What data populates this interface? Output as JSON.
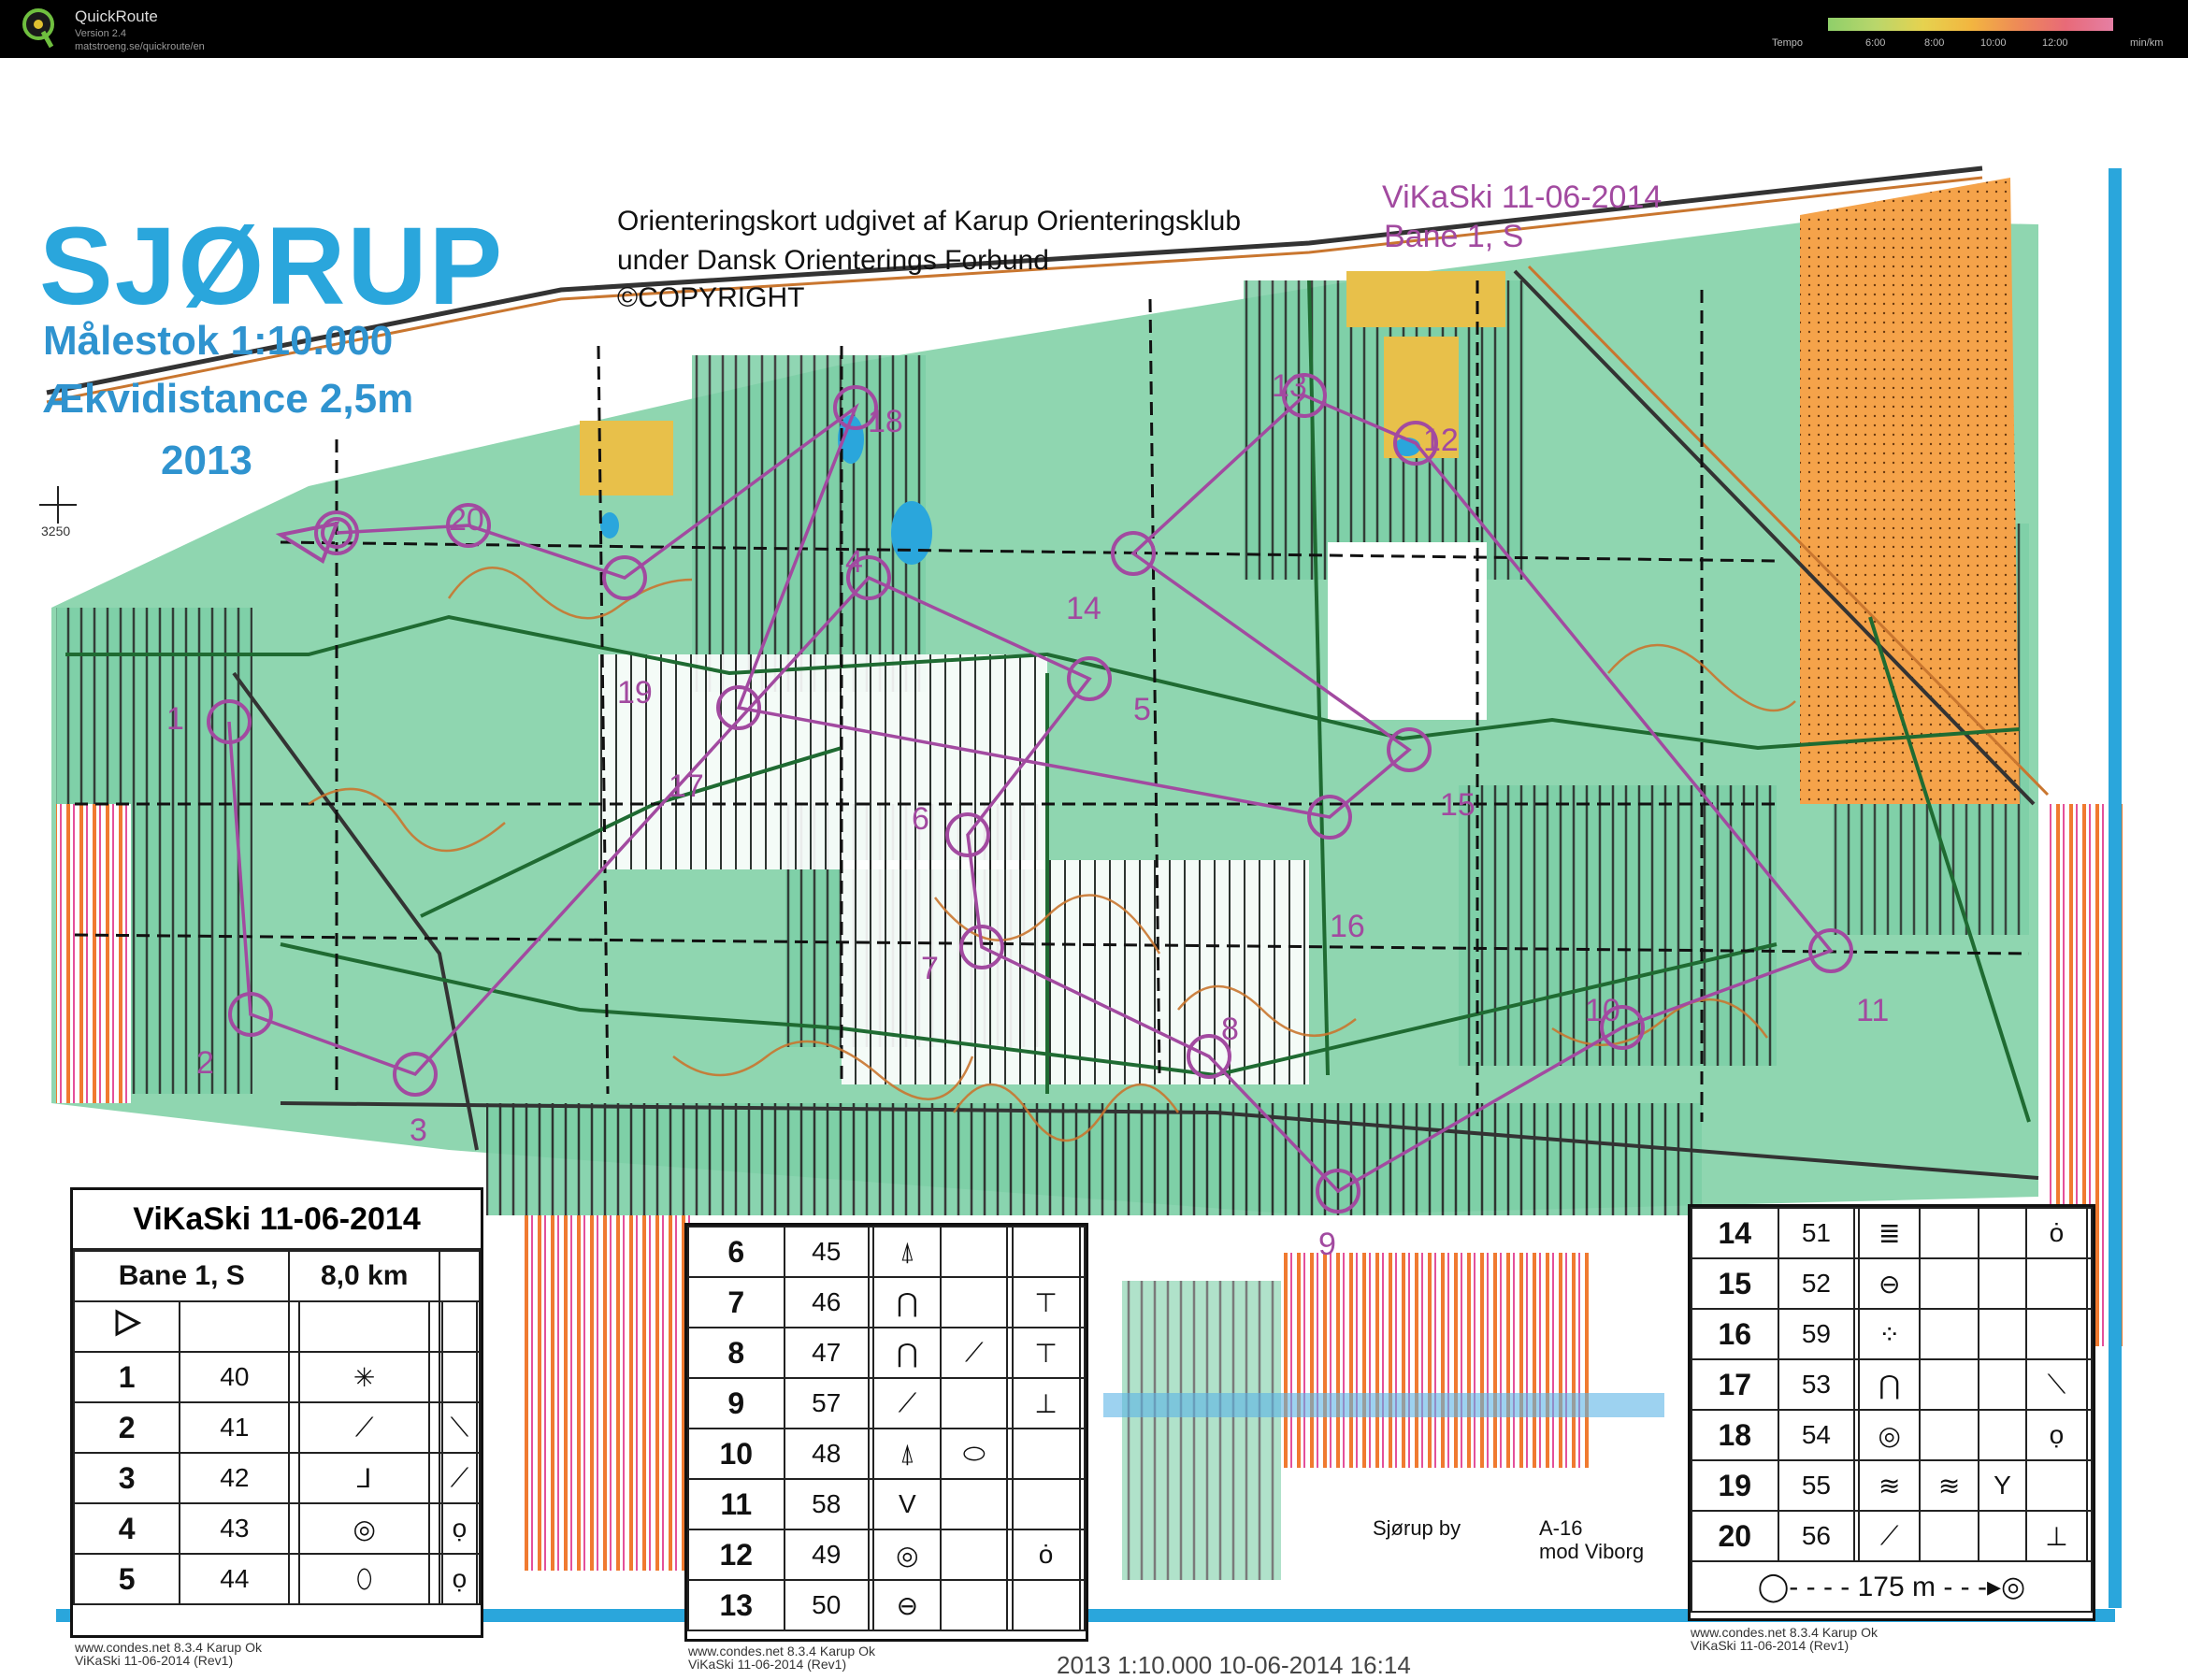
{
  "app": {
    "title": "QuickRoute",
    "version": "Version 2.4",
    "url": "matstroeng.se/quickroute/en",
    "logo_letter": "Q"
  },
  "tempo_legend": {
    "label": "Tempo",
    "ticks": [
      "6:00",
      "8:00",
      "10:00",
      "12:00"
    ],
    "unit": "min/km"
  },
  "map": {
    "title": "SJØRUP",
    "scale": "Målestok 1:10.000",
    "equidistance": "Ækvidistance 2,5m",
    "year": "2013",
    "publisher_line1": "Orienteringskort udgivet af Karup Orienteringsklub",
    "publisher_line2": "under Dansk Orienterings Forbund",
    "copyright": "©COPYRIGHT",
    "event": "ViKaSki 11-06-2014",
    "course": "Bane 1, S",
    "grid_label": "3250",
    "place_1": "Sjørup by",
    "place_2": "A-16",
    "place_3": "mod Viborg",
    "bottom_footer": "2013        1:10.000      10-06-2014  16:14",
    "controls": [
      {
        "label": "1"
      },
      {
        "label": "2"
      },
      {
        "label": "3"
      },
      {
        "label": "4"
      },
      {
        "label": "5"
      },
      {
        "label": "6"
      },
      {
        "label": "7"
      },
      {
        "label": "8"
      },
      {
        "label": "9"
      },
      {
        "label": "10"
      },
      {
        "label": "11"
      },
      {
        "label": "12"
      },
      {
        "label": "13"
      },
      {
        "label": "14"
      },
      {
        "label": "15"
      },
      {
        "label": "16"
      },
      {
        "label": "17"
      },
      {
        "label": "18"
      },
      {
        "label": "19"
      },
      {
        "label": "20"
      }
    ],
    "colors": {
      "forest": "#7ccfa6",
      "open": "#f5a34a",
      "course": "#a24aa0",
      "water": "#2aa6dc",
      "contour": "#c9762f"
    }
  },
  "control_descriptions": {
    "left": {
      "event": "ViKaSki 11-06-2014",
      "course": "Bane 1, S",
      "length": "8,0 km",
      "rows": [
        {
          "n": "1",
          "code": "40"
        },
        {
          "n": "2",
          "code": "41"
        },
        {
          "n": "3",
          "code": "42"
        },
        {
          "n": "4",
          "code": "43"
        },
        {
          "n": "5",
          "code": "44"
        }
      ],
      "footer1": "www.condes.net 8.3.4 Karup Ok",
      "footer2": "ViKaSki 11-06-2014 (Rev1)"
    },
    "middle": {
      "rows": [
        {
          "n": "6",
          "code": "45"
        },
        {
          "n": "7",
          "code": "46"
        },
        {
          "n": "8",
          "code": "47"
        },
        {
          "n": "9",
          "code": "57"
        },
        {
          "n": "10",
          "code": "48"
        },
        {
          "n": "11",
          "code": "58"
        },
        {
          "n": "12",
          "code": "49"
        },
        {
          "n": "13",
          "code": "50"
        }
      ],
      "footer1": "www.condes.net 8.3.4 Karup Ok",
      "footer2": "ViKaSki 11-06-2014 (Rev1)"
    },
    "right": {
      "rows": [
        {
          "n": "14",
          "code": "51"
        },
        {
          "n": "15",
          "code": "52"
        },
        {
          "n": "16",
          "code": "59"
        },
        {
          "n": "17",
          "code": "53"
        },
        {
          "n": "18",
          "code": "54"
        },
        {
          "n": "19",
          "code": "55"
        },
        {
          "n": "20",
          "code": "56"
        }
      ],
      "finish": "175 m",
      "footer1": "www.condes.net 8.3.4 Karup Ok",
      "footer2": "ViKaSki 11-06-2014 (Rev1)"
    }
  }
}
